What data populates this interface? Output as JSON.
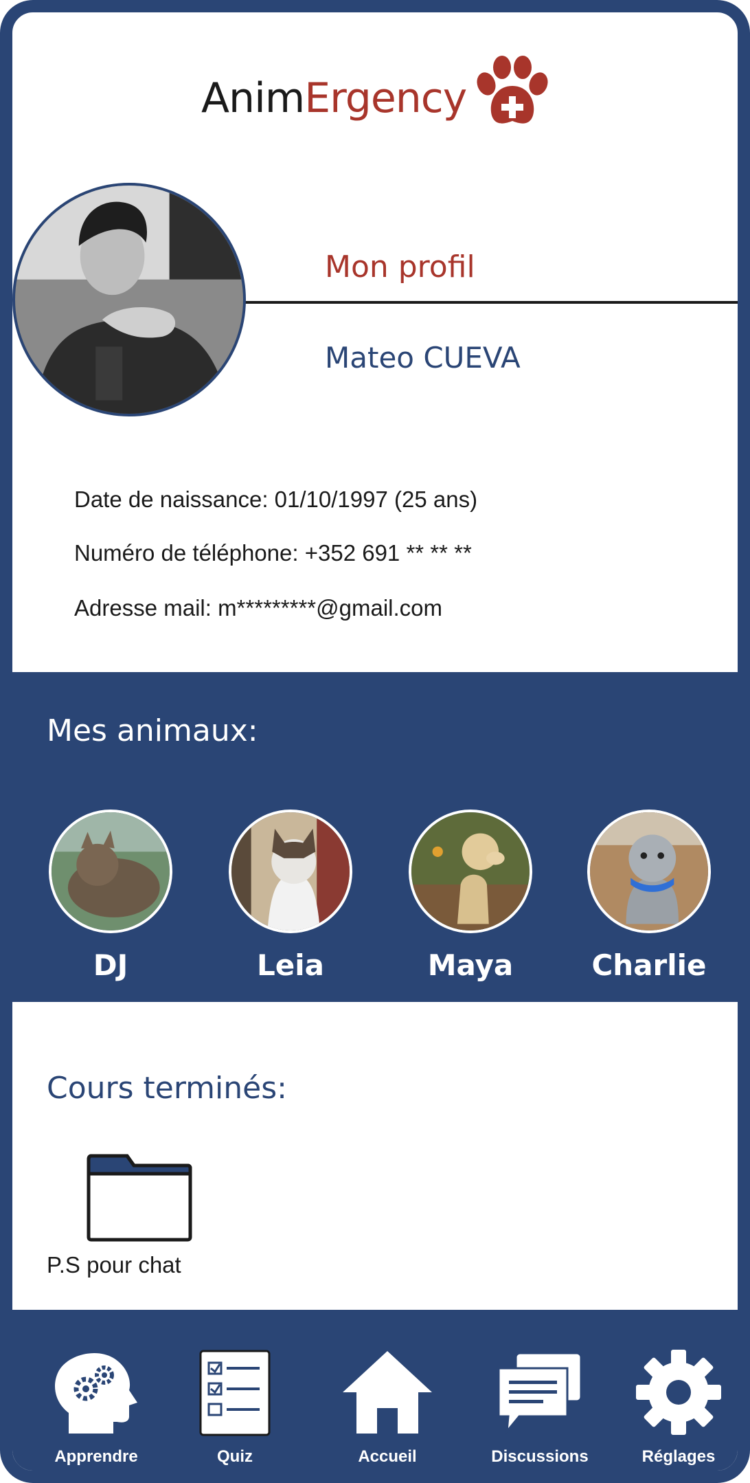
{
  "app": {
    "brand_part1": "Anim",
    "brand_part2": "Ergency",
    "logo_icon": "paw-cross-icon"
  },
  "profile": {
    "heading": "Mon profil",
    "name": "Mateo CUEVA",
    "avatar": "user-avatar-photo",
    "birth": "Date de naissance: 01/10/1997 (25 ans)",
    "phone": "Numéro de téléphone: +352 691 ** ** **",
    "email": "Adresse mail: m*********@gmail.com"
  },
  "animals": {
    "title": "Mes animaux:",
    "items": [
      {
        "name": "DJ"
      },
      {
        "name": "Leia"
      },
      {
        "name": "Maya"
      },
      {
        "name": "Charlie"
      }
    ]
  },
  "courses": {
    "title": "Cours terminés:",
    "items": [
      {
        "label": "P.S pour chat",
        "icon": "folder-icon"
      }
    ]
  },
  "nav": {
    "items": [
      {
        "label": "Apprendre",
        "icon": "head-gears-icon"
      },
      {
        "label": "Quiz",
        "icon": "checklist-icon"
      },
      {
        "label": "Accueil",
        "icon": "home-icon"
      },
      {
        "label": "Discussions",
        "icon": "chat-icon"
      },
      {
        "label": "Réglages",
        "icon": "gear-icon"
      }
    ]
  },
  "colors": {
    "primary": "#2a4575",
    "accent": "#a8352b",
    "text": "#1a1a1a",
    "background": "#ffffff"
  }
}
